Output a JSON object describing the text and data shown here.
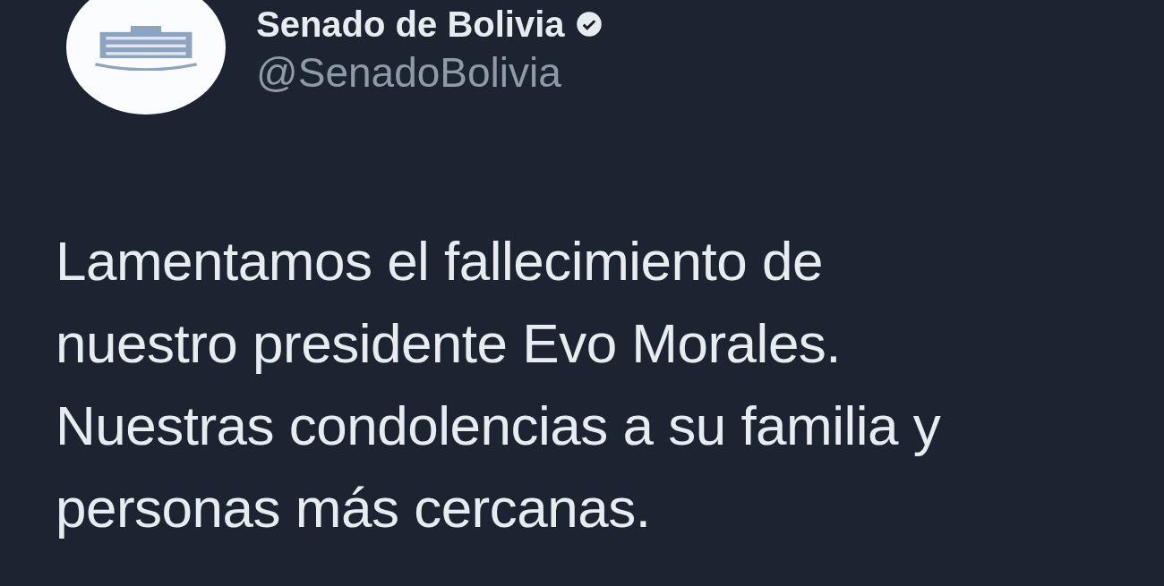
{
  "tweet": {
    "author": {
      "name": "Senado de Bolivia",
      "handle": "@SenadoBolivia",
      "verified": true
    },
    "text": [
      "Lamentamos el fallecimiento de",
      "nuestro presidente Evo Morales.",
      "Nuestras condolencias a su familia y",
      "personas más cercanas."
    ]
  }
}
